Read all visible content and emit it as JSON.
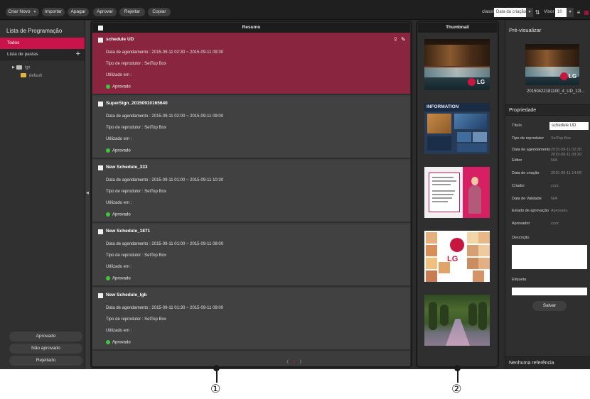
{
  "toolbar": {
    "buttons": [
      {
        "label": "Criar Novo",
        "caret": "▼"
      },
      {
        "label": "Importar"
      },
      {
        "label": "Apagar"
      },
      {
        "label": "Aprovar"
      },
      {
        "label": "Rejeitar"
      },
      {
        "label": "Copiar"
      }
    ],
    "sort_label": "classificar",
    "sort_value": "Data da criação",
    "sort_order_icon": "⇅",
    "view_label": "Visor",
    "view_value": "10",
    "dropdown_arrow": "▼",
    "list_view_icon": "≡",
    "grid_view_icon": "▦"
  },
  "sidebar": {
    "title": "Lista de Programação",
    "all_label": "Todos",
    "folders_label": "Lista de pastas",
    "add_icon": "+",
    "tree": [
      {
        "label": "lgx",
        "arrow": "▶"
      },
      {
        "label": "default"
      }
    ],
    "status_buttons": [
      "Aprovado",
      "Não aprovado",
      "Rejeitado"
    ],
    "collapse_arrow": "◀"
  },
  "summary": {
    "header": "Resumo",
    "field_schedule": "Data de agendamento :",
    "field_player": "Tipo de reprodutor :",
    "field_used": "Utilizado em :",
    "items": [
      {
        "title": "schedule UD",
        "schedule": "2015-09-11 02:30 ~ 2015-09-11 09:30",
        "player": "SetTop Box",
        "used": "",
        "status": "Aprovado",
        "upload_icon": "⇪",
        "edit_icon": "✎"
      },
      {
        "title": "SuperSign_20150910165640",
        "schedule": "2015-09-11 02:00 ~ 2015-09-11 09:00",
        "player": "SetTop Box",
        "used": "",
        "status": "Aprovado"
      },
      {
        "title": "New Schedule_333",
        "schedule": "2015-09-11 01:00 ~ 2015-09-11 10:30",
        "player": "SetTop Box",
        "used": "",
        "status": "Aprovado"
      },
      {
        "title": "New Schedule_1871",
        "schedule": "2015-09-11 01:00 ~ 2015-09-11 08:00",
        "player": "SetTop Box",
        "used": "",
        "status": "Aprovado"
      },
      {
        "title": "New Schedule_lgb",
        "schedule": "2015-09-11 01:30 ~ 2015-09-11 09:00",
        "player": "SetTop Box",
        "used": "",
        "status": "Aprovado"
      }
    ],
    "pager": {
      "prev": "〈",
      "page": "1",
      "next": "〉"
    }
  },
  "thumbnails": {
    "header": "Thumbnail",
    "info_title": "INFORMATION",
    "brand": "LG"
  },
  "preview": {
    "title": "Pré-visualizar",
    "filename": "20150422181100_4_UD_12l...",
    "properties_label": "Propriedade",
    "fields": {
      "title_label": "Título",
      "title_value": "schedule UD",
      "player_label": "Tipo de reprodutor",
      "player_value": "SetTop Box",
      "schedule_label": "Data de agendamento",
      "schedule_value_1": "2015-09-11 02:30",
      "schedule_value_2": "2015-09-11 09:30",
      "editor_label": "Editor",
      "editor_value": "N/A",
      "created_label": "Data de criação",
      "created_value": "2015-09-11 14:08",
      "creator_label": "Criador",
      "creator_value": "zzzz",
      "validity_label": "Data de Validade",
      "validity_value": "N/A",
      "approval_state_label": "Estado de aprovação",
      "approval_state_value": "Aprovado",
      "approver_label": "Aprovador",
      "approver_value": "zzzz",
      "description_label": "Descrição",
      "tag_label": "Etiqueta"
    },
    "save_label": "Salvar",
    "no_reference_label": "Nenhuma referência"
  },
  "callouts": [
    "①",
    "②"
  ],
  "colors": {
    "accent": "#c8144a",
    "selected_row": "#8a2540",
    "approved_dot": "#3cc83c",
    "toolbar_bg": "#1f1f1f",
    "panel_bg": "#3c3c3c"
  }
}
